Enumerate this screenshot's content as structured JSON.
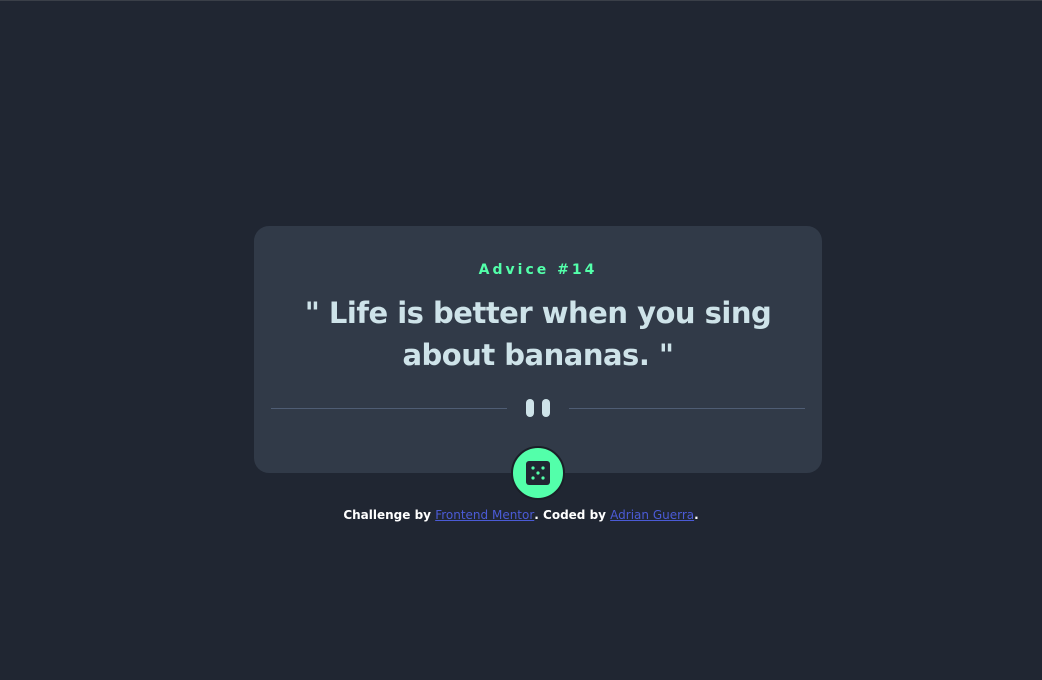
{
  "card": {
    "advice_label": "Advice #14",
    "quote": "\" Life is better when you sing about bananas. \""
  },
  "divider": {
    "icon": "pause-icon"
  },
  "dice_button": {
    "icon": "dice-icon"
  },
  "attribution": {
    "prefix": "Challenge by ",
    "link1": "Frontend Mentor",
    "middle": ". Coded by ",
    "link2": "Adrian Guerra",
    "suffix": "."
  },
  "colors": {
    "background": "#202632",
    "card": "#313a48",
    "accent": "#53ffaa",
    "text": "#cee3e9",
    "divider": "#4f5d74",
    "link": "#4b5bd6"
  }
}
